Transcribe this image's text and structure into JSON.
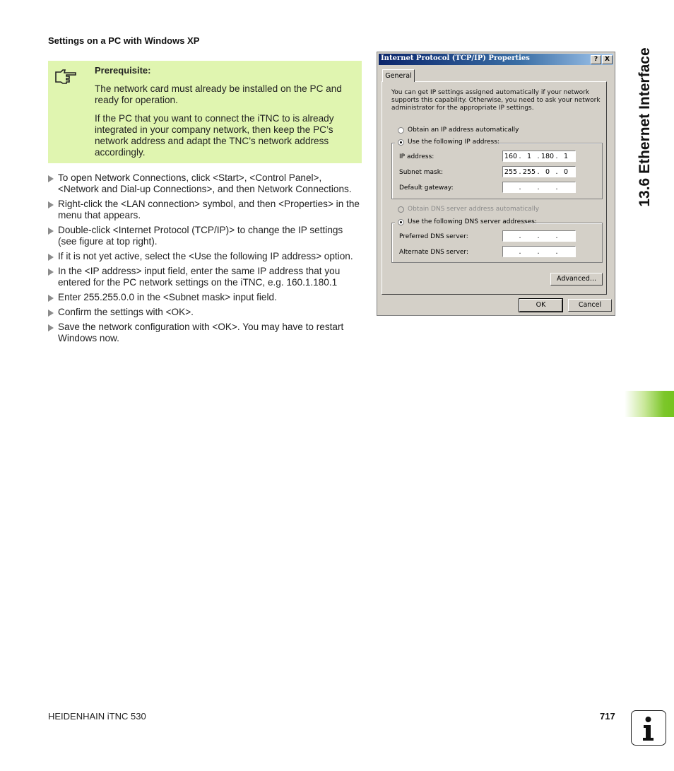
{
  "section": {
    "heading": "Settings on a PC with Windows XP"
  },
  "note": {
    "icon": "pointing-hand-icon",
    "title": "Prerequisite:",
    "paragraphs": [
      "The network card must already be installed on the PC and ready for operation.",
      "If the PC that you want to connect the iTNC to is already integrated in your company network, then keep the PC’s network address and adapt the TNC’s network address accordingly."
    ],
    "background_color": "#e0f5b0"
  },
  "steps": [
    "To open Network Connections, click <Start>, <Control Panel>, <Network and Dial-up Connections>, and then Network Connections.",
    "Right-click the <LAN connection> symbol, and then <Properties> in the menu that appears.",
    "Double-click <Internet Protocol (TCP/IP)> to change the IP settings (see figure at top right).",
    "If it is not yet active, select the <Use the following IP address> option.",
    "In the <IP address> input field, enter the same IP address that you entered for the PC network settings on the iTNC, e.g. 160.1.180.1",
    "Enter 255.255.0.0 in the <Subnet mask> input field.",
    "Confirm the settings with <OK>.",
    "Save the network configuration with <OK>. You may have to restart Windows now."
  ],
  "dialog": {
    "title": "Internet Protocol (TCP/IP) Properties",
    "help_button": "?",
    "close_button": "X",
    "tab": "General",
    "intro": "You can get IP settings assigned automatically if your network supports this capability. Otherwise, you need to ask your network administrator for the appropriate IP settings.",
    "ip_auto_label": "Obtain an IP address automatically",
    "ip_manual_label": "Use the following IP address:",
    "ip_mode": "manual",
    "fields": {
      "ip_label": "IP address:",
      "ip_value": [
        "160",
        "1",
        "180",
        "1"
      ],
      "subnet_label": "Subnet mask:",
      "subnet_value": [
        "255",
        "255",
        "0",
        "0"
      ],
      "gateway_label": "Default gateway:",
      "gateway_value": [
        "",
        "",
        "",
        ""
      ]
    },
    "dns_auto_label": "Obtain DNS server address automatically",
    "dns_manual_label": "Use the following DNS server addresses:",
    "dns_mode": "manual",
    "dns": {
      "preferred_label": "Preferred DNS server:",
      "preferred_value": [
        "",
        "",
        "",
        ""
      ],
      "alternate_label": "Alternate DNS server:",
      "alternate_value": [
        "",
        "",
        "",
        ""
      ]
    },
    "advanced_button": "Advanced...",
    "ok_button": "OK",
    "cancel_button": "Cancel"
  },
  "side_title": "13.6 Ethernet Interface",
  "footer": {
    "left": "HEIDENHAIN iTNC 530",
    "page": "717",
    "icon": "info-icon"
  },
  "colors": {
    "accent_green": "#74c41f",
    "note_bg": "#e0f5b0",
    "titlebar": "#0a246a"
  }
}
